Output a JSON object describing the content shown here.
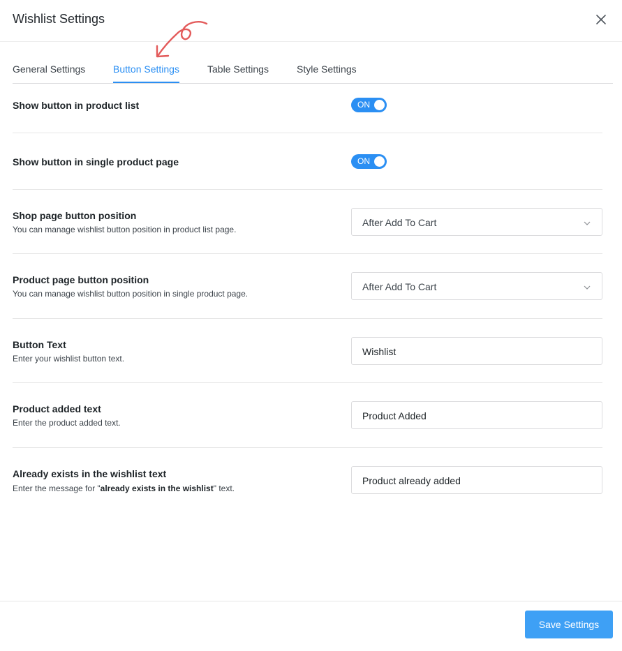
{
  "modal": {
    "title": "Wishlist Settings"
  },
  "tabs": [
    {
      "label": "General Settings"
    },
    {
      "label": "Button Settings"
    },
    {
      "label": "Table Settings"
    },
    {
      "label": "Style Settings"
    }
  ],
  "settings": {
    "show_in_list": {
      "label": "Show button in product list",
      "toggle": "ON"
    },
    "show_in_single": {
      "label": "Show button in single product page",
      "toggle": "ON"
    },
    "shop_position": {
      "label": "Shop page button position",
      "desc": "You can manage wishlist button position in product list page.",
      "value": "After Add To Cart"
    },
    "product_position": {
      "label": "Product page button position",
      "desc": "You can manage wishlist button position in single product page.",
      "value": "After Add To Cart"
    },
    "button_text": {
      "label": "Button Text",
      "desc": "Enter your wishlist button text.",
      "value": "Wishlist"
    },
    "added_text": {
      "label": "Product added text",
      "desc": "Enter the product added text.",
      "value": "Product Added"
    },
    "exists_text": {
      "label": "Already exists in the wishlist text",
      "desc_before": "Enter the message for \"",
      "desc_bold": "already exists in the wishlist",
      "desc_after": "\" text.",
      "value": "Product already added"
    }
  },
  "footer": {
    "save_label": "Save Settings"
  },
  "colors": {
    "accent": "#2b8ff3",
    "save_button": "#3ea0f5",
    "annotation_arrow": "#e35a5a"
  }
}
